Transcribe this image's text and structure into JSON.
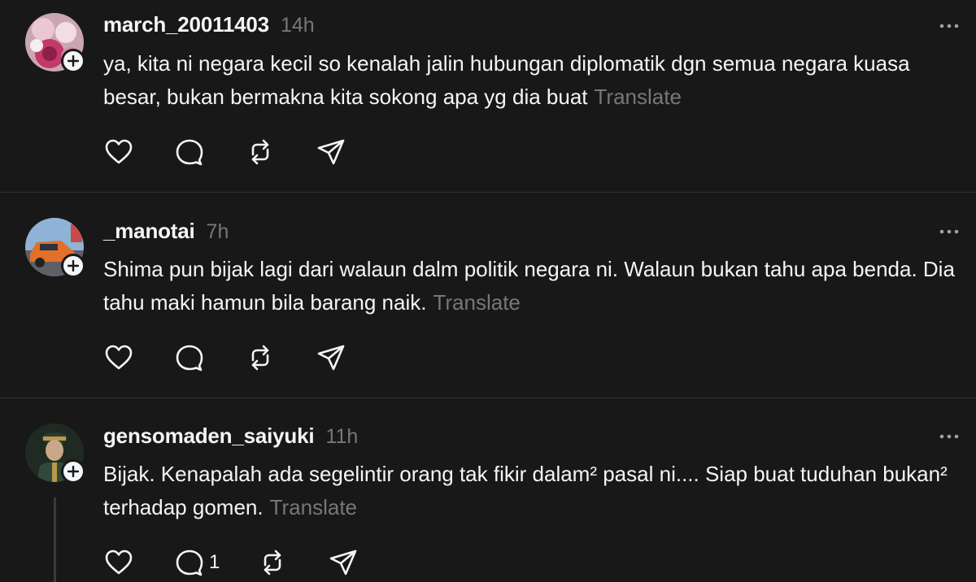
{
  "posts": [
    {
      "username": "march_20011403",
      "time": "14h",
      "text": "ya, kita ni negara kecil so kenalah jalin hubungan diplomatik dgn semua negara kuasa besar, bukan bermakna kita sokong apa yg dia buat",
      "translate": "Translate",
      "avatar": "avatar-pink-flowers",
      "reply_count": ""
    },
    {
      "username": "_manotai",
      "time": "7h",
      "text": "Shima pun bijak lagi dari walaun dalm politik negara ni. Walaun bukan tahu apa benda. Dia tahu maki hamun bila barang naik.",
      "translate": "Translate",
      "avatar": "avatar-orange-car",
      "reply_count": ""
    },
    {
      "username": "gensomaden_saiyuki",
      "time": "11h",
      "text": "Bijak. Kenapalah ada segelintir orang tak fikir dalam² pasal ni.... Siap buat tuduhan bukan² terhadap gomen.",
      "translate": "Translate",
      "avatar": "avatar-officer-portrait",
      "reply_count": "1"
    }
  ],
  "icons": {
    "like": "heart-icon",
    "reply": "comment-icon",
    "repost": "repost-icon",
    "share": "send-icon",
    "more": "more-icon",
    "follow": "plus-icon"
  },
  "colors": {
    "background": "#181818",
    "text": "#f3f5f7",
    "muted": "#777777",
    "divider": "#323232"
  }
}
